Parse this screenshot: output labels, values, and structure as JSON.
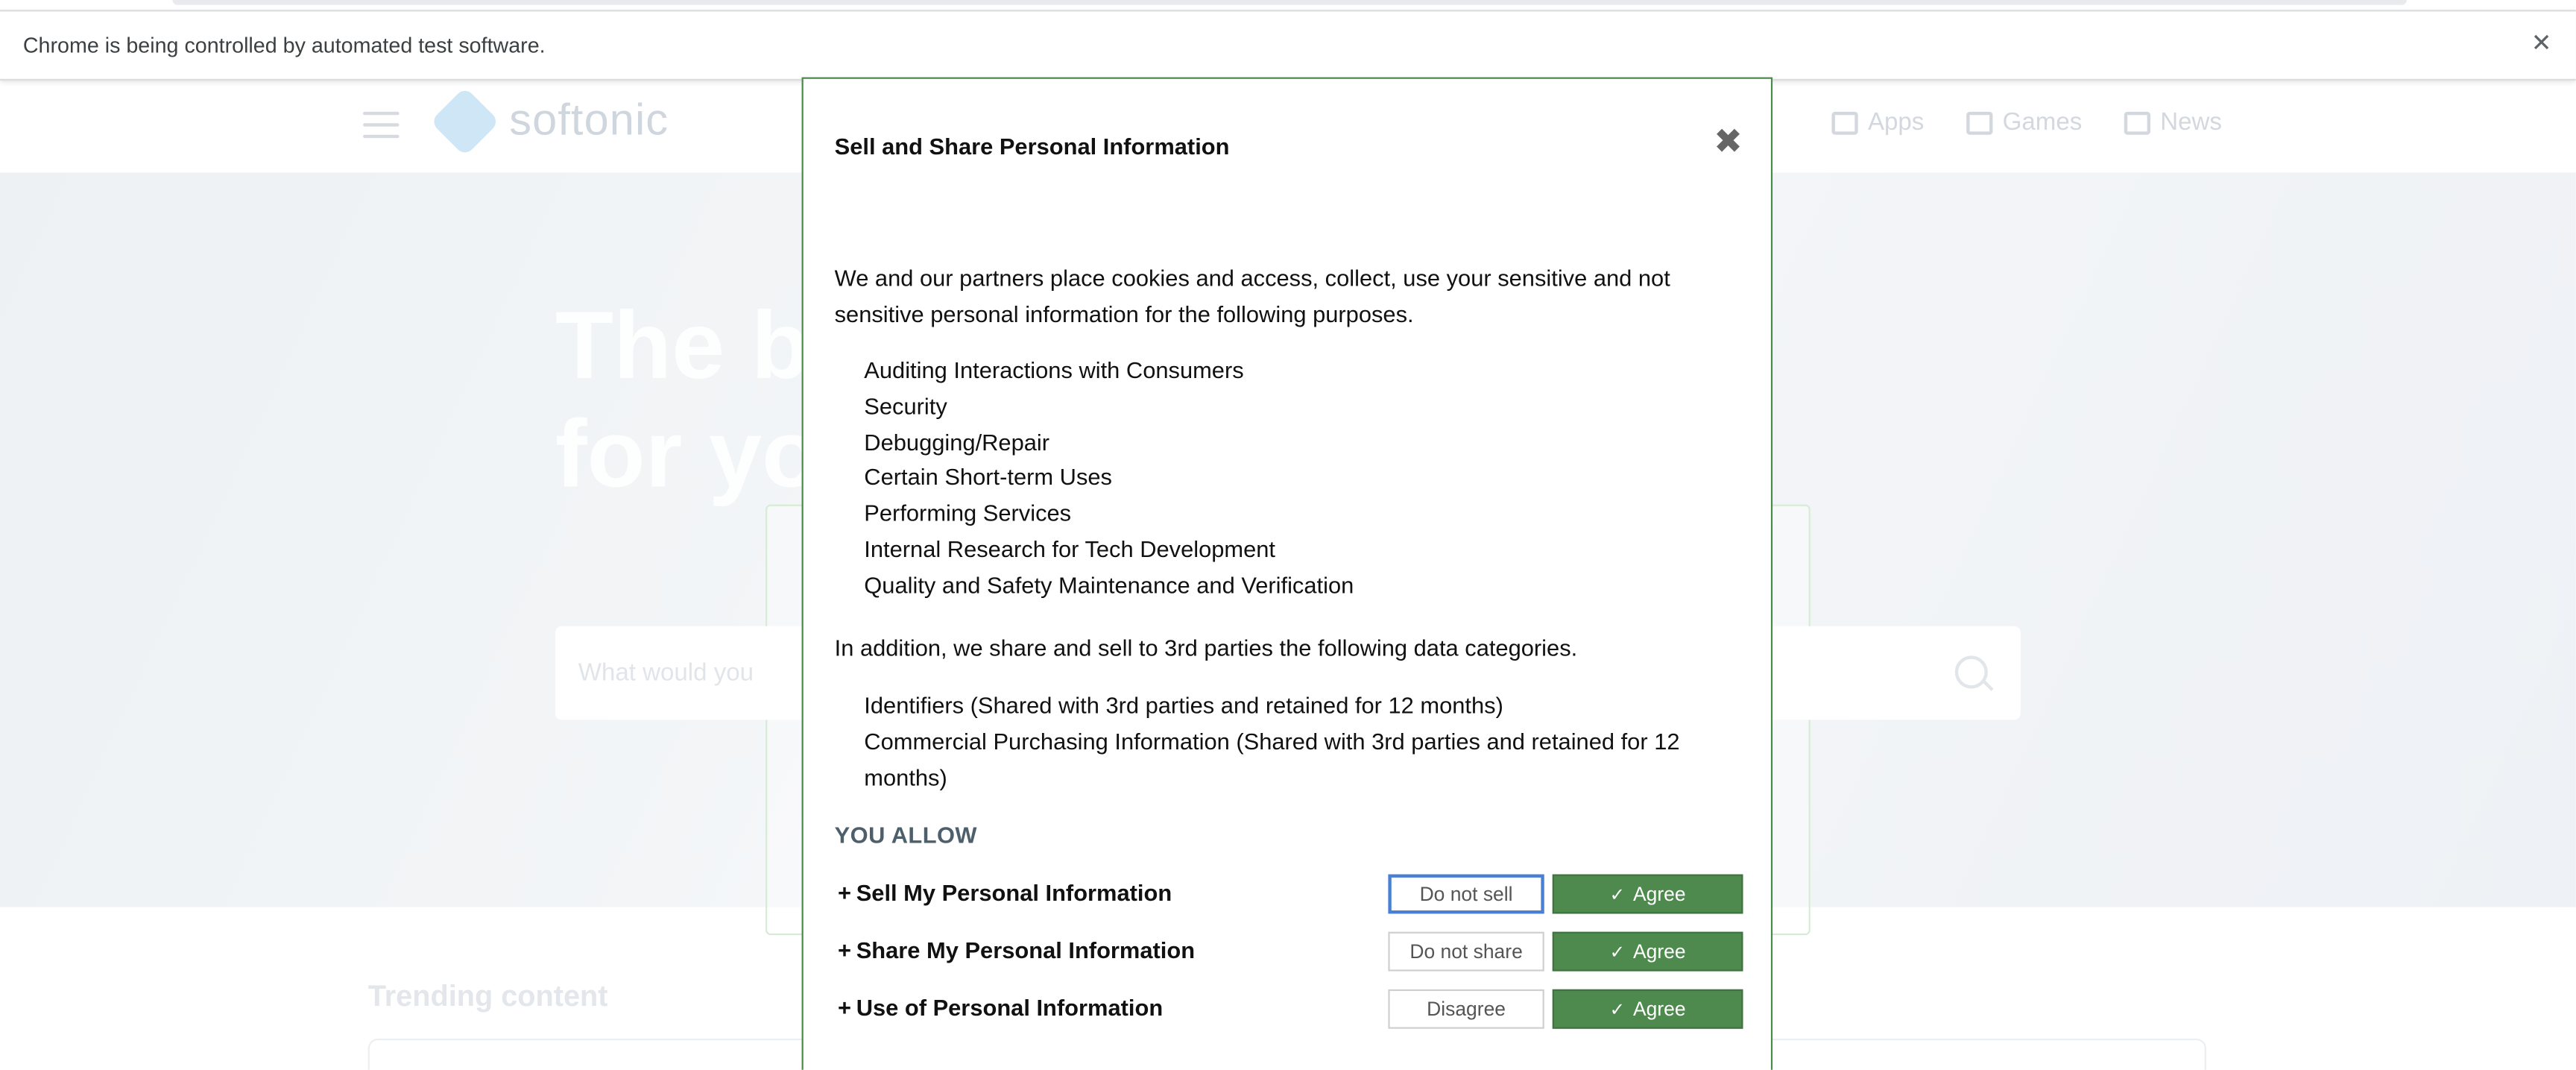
{
  "browser": {
    "infobar_message": "Chrome is being controlled by automated test software.",
    "close_glyph": "✕"
  },
  "site": {
    "logo_text": "softonic",
    "nav": [
      {
        "label": "Apps",
        "icon": "apps-icon"
      },
      {
        "label": "Games",
        "icon": "gamepad-icon"
      },
      {
        "label": "News",
        "icon": "news-icon"
      }
    ],
    "hero_title_line1": "The b",
    "hero_title_line2": "for yo",
    "search_placeholder": "What would you",
    "trending_heading": "Trending content"
  },
  "modal": {
    "title": "Sell and Share Personal Information",
    "close_glyph": "✖",
    "intro": "We and our partners place cookies and access, collect, use your sensitive and not sensitive personal information for the following purposes.",
    "purposes": [
      "Auditing Interactions with Consumers",
      "Security",
      "Debugging/Repair",
      "Certain Short-term Uses",
      "Performing Services",
      "Internal Research for Tech Development",
      "Quality and Safety Maintenance and Verification"
    ],
    "addition_text": "In addition, we share and sell to 3rd parties the following data categories.",
    "categories": [
      "Identifiers (Shared with 3rd parties and retained for 12 months)",
      "Commercial Purchasing Information (Shared with 3rd parties and retained for 12 months)"
    ],
    "you_allow_heading": "YOU ALLOW",
    "rows": [
      {
        "label": "Sell My Personal Information",
        "deny": "Do not sell",
        "agree": "Agree"
      },
      {
        "label": "Share My Personal Information",
        "deny": "Do not share",
        "agree": "Agree"
      },
      {
        "label": "Use of Personal Information",
        "deny": "Disagree",
        "agree": "Agree"
      }
    ],
    "expand_glyph": "+",
    "check_glyph": "✓"
  },
  "colors": {
    "agree_green": "#4e8a4e",
    "modal_border": "#4a8a4a",
    "focus_blue": "#4a7fd6",
    "heading_slate": "#4d5f6b"
  }
}
